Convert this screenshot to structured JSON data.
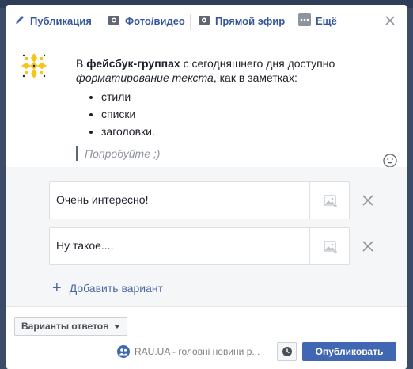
{
  "tabs": [
    {
      "label": "Публикация",
      "icon": "pencil-icon"
    },
    {
      "label": "Фото/видео",
      "icon": "camera-icon"
    },
    {
      "label": "Прямой эфир",
      "icon": "video-camera-icon"
    },
    {
      "label": "Ещё",
      "icon": "more-icon"
    }
  ],
  "post": {
    "p1": "В ",
    "bold": "фейсбук-группах",
    "p2": " с сегодняшнего дня доступно ",
    "italic": "форматирование текста",
    "p3": ", как в заметках:",
    "list": [
      "стили",
      "списки",
      "заголовки."
    ],
    "try_placeholder": "Попробуйте ;)"
  },
  "poll": {
    "options": [
      {
        "text": "Очень интересно!"
      },
      {
        "text": "Ну такое...."
      }
    ],
    "add_label": "Добавить вариант"
  },
  "footer": {
    "variants_label": "Варианты ответов",
    "audience": "RAU.UA - головні новини р...",
    "publish_label": "Опубликовать"
  },
  "colors": {
    "link_blue": "#365899",
    "button_blue": "#4267b2",
    "accent_yellow": "#f5c518"
  }
}
